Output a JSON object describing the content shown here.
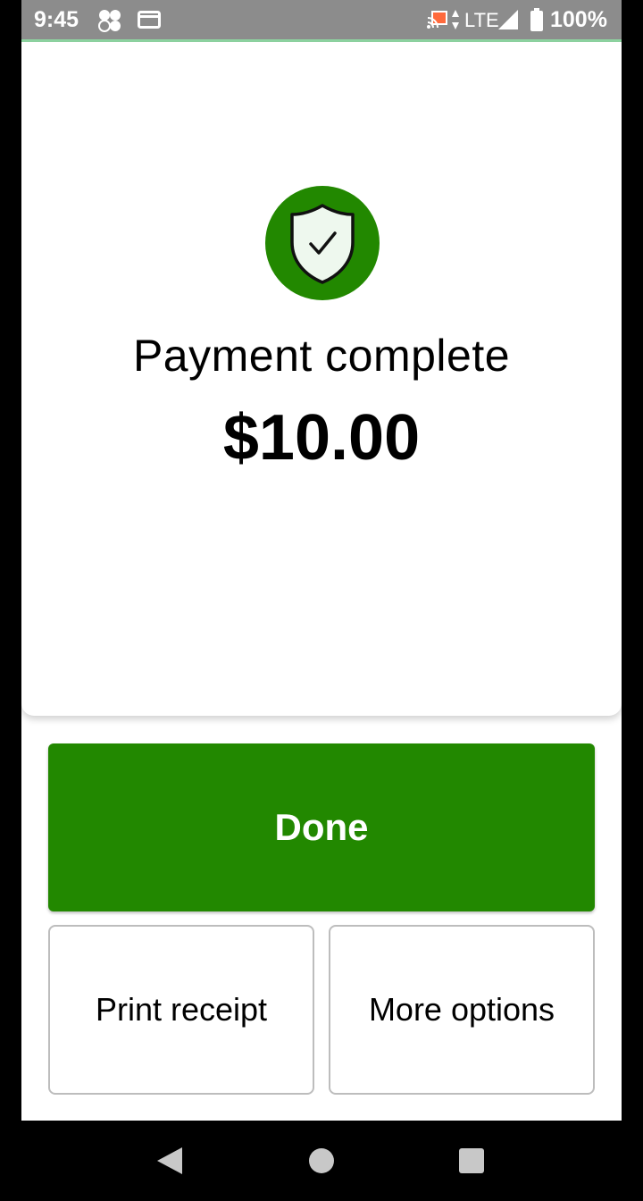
{
  "status_bar": {
    "time": "9:45",
    "network": "LTE",
    "battery": "100%",
    "icons": [
      "clover-icon",
      "card-icon",
      "cast-icon",
      "data-arrows-icon",
      "signal-icon",
      "battery-icon"
    ]
  },
  "payment": {
    "icon": "shield-check-icon",
    "title": "Payment complete",
    "amount": "$10.00"
  },
  "actions": {
    "done_label": "Done",
    "print_label": "Print receipt",
    "more_label": "More options"
  },
  "nav_bar": {
    "icons": [
      "back-icon",
      "home-icon",
      "recents-icon"
    ]
  },
  "colors": {
    "brand_green": "#228800",
    "shield_fill": "#eef8ee",
    "status_bar": "#8c8c8c"
  }
}
